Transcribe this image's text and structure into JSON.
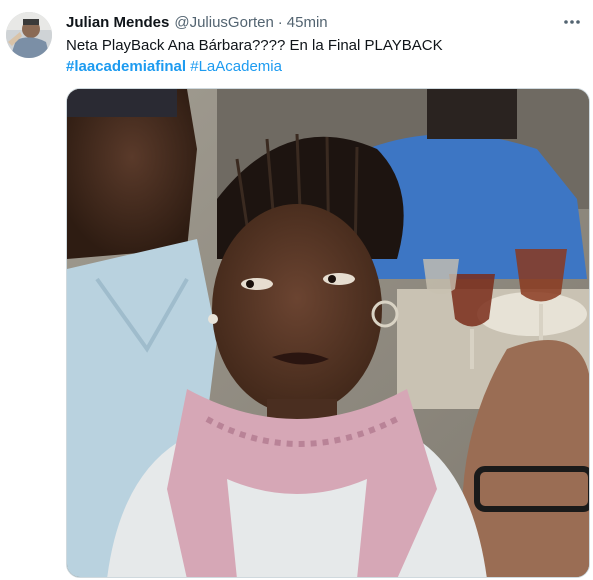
{
  "tweet": {
    "author": {
      "display_name": "Julian Mendes",
      "handle": "@JuliusGorten",
      "separator": "·",
      "time": "45min"
    },
    "text": "Neta PlayBack Ana Bárbara???? En la Final PLAYBACK",
    "hashtags": [
      {
        "label": "#laacademiafinal"
      },
      {
        "label": "#LaAcademia"
      }
    ],
    "more_icon": "more-horizontal-icon",
    "colors": {
      "link": "#1d9bf0",
      "muted": "#536471",
      "text": "#0f1419"
    }
  }
}
